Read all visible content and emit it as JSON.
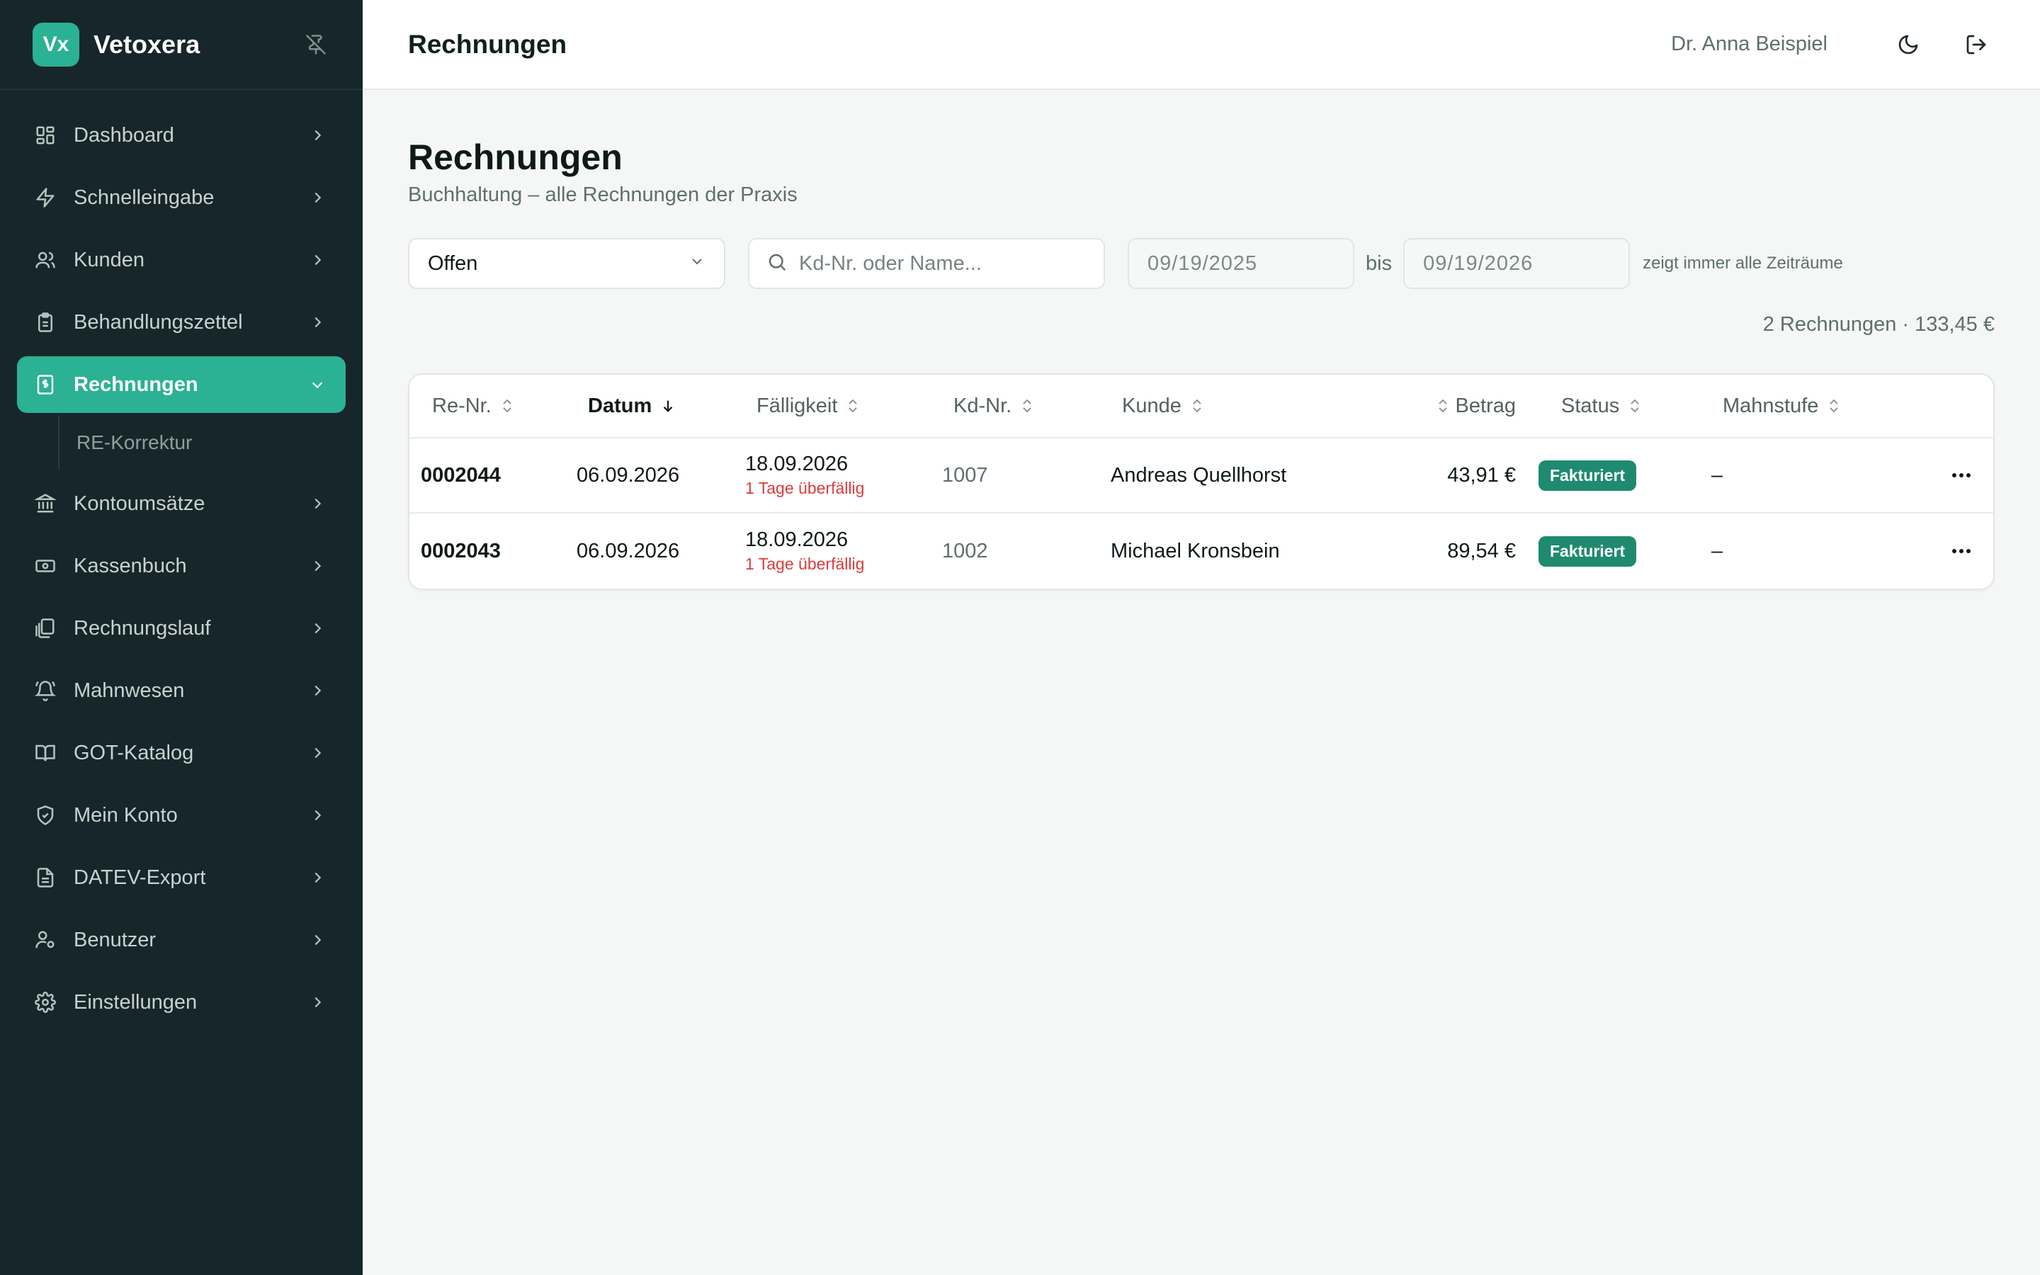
{
  "brand": {
    "logo_text": "Vx",
    "name": "Vetoxera",
    "accent": "#2bb194"
  },
  "sidebar": {
    "items": [
      {
        "label": "Dashboard",
        "icon": "grid-icon"
      },
      {
        "label": "Schnelleingabe",
        "icon": "bolt-icon"
      },
      {
        "label": "Kunden",
        "icon": "users-icon"
      },
      {
        "label": "Behandlungszettel",
        "icon": "clipboard-icon"
      },
      {
        "label": "Rechnungen",
        "icon": "invoice-icon",
        "active": true
      },
      {
        "label": "Kontoumsätze",
        "icon": "bank-icon"
      },
      {
        "label": "Kassenbuch",
        "icon": "cash-icon"
      },
      {
        "label": "Rechnungslauf",
        "icon": "copies-icon"
      },
      {
        "label": "Mahnwesen",
        "icon": "bell-icon"
      },
      {
        "label": "GOT-Katalog",
        "icon": "book-icon"
      },
      {
        "label": "Mein Konto",
        "icon": "shield-icon"
      },
      {
        "label": "DATEV-Export",
        "icon": "file-icon"
      },
      {
        "label": "Benutzer",
        "icon": "user-gear-icon"
      },
      {
        "label": "Einstellungen",
        "icon": "gear-icon"
      }
    ],
    "sub_item": "RE-Korrektur"
  },
  "header": {
    "title": "Rechnungen",
    "user": "Dr. Anna Beispiel"
  },
  "page": {
    "title": "Rechnungen",
    "subtitle": "Buchhaltung – alle Rechnungen der Praxis"
  },
  "filters": {
    "status_value": "Offen",
    "search_placeholder": "Kd-Nr. oder Name...",
    "date_from": "09/19/2025",
    "date_sep": "bis",
    "date_to": "09/19/2026",
    "hint": "zeigt immer alle Zeiträume"
  },
  "summary": "2 Rechnungen · 133,45 €",
  "table": {
    "columns": {
      "nr": "Re-Nr.",
      "datum": "Datum",
      "faelligkeit": "Fälligkeit",
      "kdnr": "Kd-Nr.",
      "kunde": "Kunde",
      "betrag": "Betrag",
      "status": "Status",
      "mahnstufe": "Mahnstufe"
    },
    "rows": [
      {
        "nr": "0002044",
        "datum": "06.09.2026",
        "faellig": "18.09.2026",
        "overdue": "1 Tage überfällig",
        "kdnr": "1007",
        "kunde": "Andreas Quellhorst",
        "betrag": "43,91 €",
        "status": "Fakturiert",
        "mahnstufe": "–"
      },
      {
        "nr": "0002043",
        "datum": "06.09.2026",
        "faellig": "18.09.2026",
        "overdue": "1 Tage überfällig",
        "kdnr": "1002",
        "kunde": "Michael Kronsbein",
        "betrag": "89,54 €",
        "status": "Fakturiert",
        "mahnstufe": "–"
      }
    ]
  },
  "colors": {
    "sidebar_bg": "#16262a",
    "status_badge": "#1f8a70",
    "overdue_text": "#dc3b3b"
  }
}
